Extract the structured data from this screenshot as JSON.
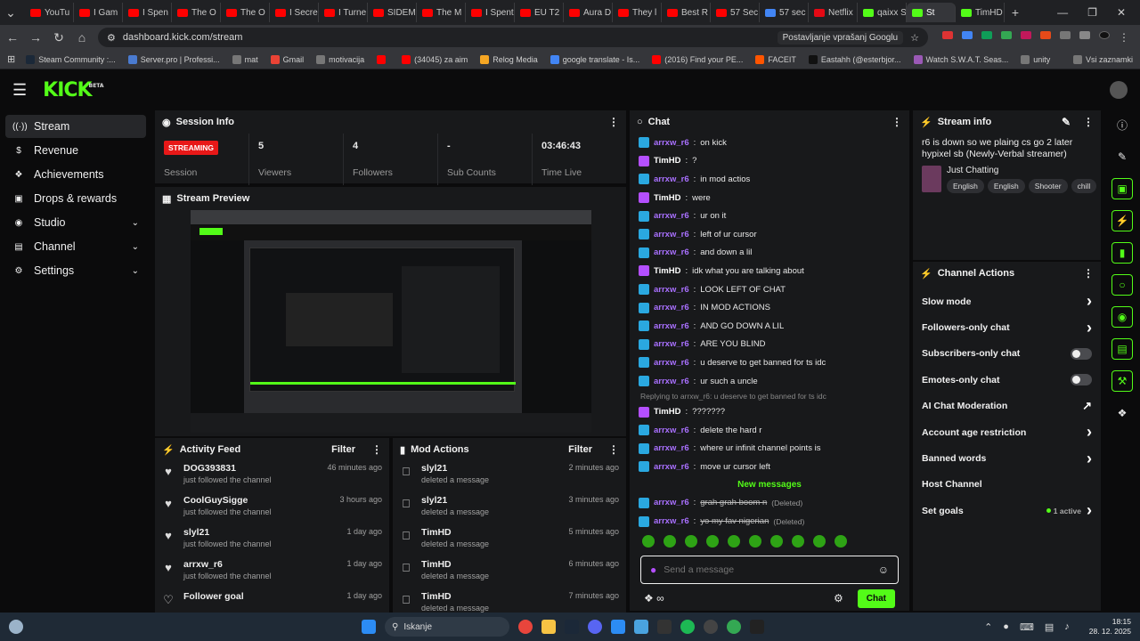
{
  "browser": {
    "tabs": [
      {
        "label": "YouTu",
        "color": "#ff0000"
      },
      {
        "label": "I Gam",
        "color": "#ff0000"
      },
      {
        "label": "I Spen",
        "color": "#ff0000"
      },
      {
        "label": "The O",
        "color": "#ff0000"
      },
      {
        "label": "The O",
        "color": "#ff0000"
      },
      {
        "label": "I Secre",
        "color": "#ff0000"
      },
      {
        "label": "I Turne",
        "color": "#ff0000"
      },
      {
        "label": "SIDEM",
        "color": "#ff0000"
      },
      {
        "label": "The M",
        "color": "#ff0000"
      },
      {
        "label": "I Spent",
        "color": "#ff0000"
      },
      {
        "label": "EU T2",
        "color": "#ff0000"
      },
      {
        "label": "Aura D",
        "color": "#ff0000"
      },
      {
        "label": "They l",
        "color": "#ff0000"
      },
      {
        "label": "Best R",
        "color": "#ff0000"
      },
      {
        "label": "57 Sec",
        "color": "#ff0000"
      },
      {
        "label": "57 sec",
        "color": "#4285f4"
      },
      {
        "label": "Netflix",
        "color": "#e50914"
      },
      {
        "label": "qaixx S",
        "color": "#53fc18"
      },
      {
        "label": "St",
        "color": "#53fc18",
        "active": true
      },
      {
        "label": "TimHD",
        "color": "#53fc18"
      }
    ],
    "url": "dashboard.kick.com/stream",
    "translate_label": "Postavljanje vprašanj Googlu",
    "bookmarks": [
      {
        "label": "Steam Community :...",
        "color": "#1b2838"
      },
      {
        "label": "Server.pro | Professi...",
        "color": "#4a7bd0"
      },
      {
        "label": "mat",
        "color": "#777"
      },
      {
        "label": "Gmail",
        "color": "#ea4335"
      },
      {
        "label": "motivacija",
        "color": "#777"
      },
      {
        "label": "",
        "color": "#ff0000"
      },
      {
        "label": "(34045) za aim",
        "color": "#ff0000"
      },
      {
        "label": "Relog Media",
        "color": "#f5a623"
      },
      {
        "label": "google translate - Is...",
        "color": "#4285f4"
      },
      {
        "label": "(2016) Find your PE...",
        "color": "#ff0000"
      },
      {
        "label": "FACEIT",
        "color": "#ff5500"
      },
      {
        "label": "Eastahh (@esterbjor...",
        "color": "#111"
      },
      {
        "label": "Watch S.W.A.T. Seas...",
        "color": "#9b59b6"
      },
      {
        "label": "unity",
        "color": "#777"
      },
      {
        "label": "Prevedi",
        "color": "#4285f4"
      }
    ],
    "all_bookmarks_label": "Vsi zaznamki"
  },
  "header": {
    "logo": "KICK",
    "logo_sup": "BETA"
  },
  "sidebar": {
    "items": [
      {
        "label": "Stream",
        "icon": "broadcast-icon",
        "glyph": "((·))",
        "selected": true,
        "chev": false
      },
      {
        "label": "Revenue",
        "icon": "money-icon",
        "glyph": "$",
        "chev": false
      },
      {
        "label": "Achievements",
        "icon": "trophy-icon",
        "glyph": "❖",
        "chev": false
      },
      {
        "label": "Drops & rewards",
        "icon": "gift-icon",
        "glyph": "▣",
        "chev": false
      },
      {
        "label": "Studio",
        "icon": "studio-icon",
        "glyph": "◉",
        "chev": true
      },
      {
        "label": "Channel",
        "icon": "channel-icon",
        "glyph": "▤",
        "chev": true
      },
      {
        "label": "Settings",
        "icon": "gear-icon",
        "glyph": "⚙",
        "chev": true
      }
    ]
  },
  "session": {
    "title": "Session Info",
    "live_badge": "STREAMING",
    "session_label": "Session",
    "stats": [
      {
        "value": "5",
        "label": "Viewers"
      },
      {
        "value": "4",
        "label": "Followers"
      },
      {
        "value": "-",
        "label": "Sub Counts"
      },
      {
        "value": "03:46:43",
        "label": "Time Live"
      }
    ]
  },
  "preview": {
    "title": "Stream Preview"
  },
  "activity": {
    "title": "Activity Feed",
    "filter": "Filter",
    "rows": [
      {
        "name": "DOG393831",
        "sub": "just followed the channel",
        "time": "46 minutes ago"
      },
      {
        "name": "CoolGuySigge",
        "sub": "just followed the channel",
        "time": "3 hours ago"
      },
      {
        "name": "slyl21",
        "sub": "just followed the channel",
        "time": "1 day ago"
      },
      {
        "name": "arrxw_r6",
        "sub": "just followed the channel",
        "time": "1 day ago"
      },
      {
        "name": "Follower goal",
        "sub": "",
        "time": "1 day ago"
      }
    ]
  },
  "mod_actions": {
    "title": "Mod Actions",
    "filter": "Filter",
    "rows": [
      {
        "name": "slyl21",
        "sub": "deleted a message",
        "time": "2 minutes ago"
      },
      {
        "name": "slyl21",
        "sub": "deleted a message",
        "time": "3 minutes ago"
      },
      {
        "name": "TimHD",
        "sub": "deleted a message",
        "time": "5 minutes ago"
      },
      {
        "name": "TimHD",
        "sub": "deleted a message",
        "time": "6 minutes ago"
      },
      {
        "name": "TimHD",
        "sub": "deleted a message",
        "time": "7 minutes ago"
      }
    ]
  },
  "chat": {
    "title": "Chat",
    "messages": [
      {
        "user": "arrxw_r6",
        "text": "on kick",
        "color": "#a970ff",
        "badge": "#2aa8e0"
      },
      {
        "user": "TimHD",
        "text": "?",
        "color": "#ffffff",
        "badge": "#b44fff"
      },
      {
        "user": "arrxw_r6",
        "text": "in mod actios",
        "color": "#a970ff",
        "badge": "#2aa8e0"
      },
      {
        "user": "TimHD",
        "text": "were",
        "color": "#ffffff",
        "badge": "#b44fff"
      },
      {
        "user": "arrxw_r6",
        "text": "ur on it",
        "color": "#a970ff",
        "badge": "#2aa8e0"
      },
      {
        "user": "arrxw_r6",
        "text": "left of ur cursor",
        "color": "#a970ff",
        "badge": "#2aa8e0"
      },
      {
        "user": "arrxw_r6",
        "text": "and down a lil",
        "color": "#a970ff",
        "badge": "#2aa8e0"
      },
      {
        "user": "TimHD",
        "text": "idk what you are talking about",
        "color": "#ffffff",
        "badge": "#b44fff"
      },
      {
        "user": "arrxw_r6",
        "text": "LOOK LEFT OF CHAT",
        "color": "#a970ff",
        "badge": "#2aa8e0"
      },
      {
        "user": "arrxw_r6",
        "text": "IN MOD ACTIONS",
        "color": "#a970ff",
        "badge": "#2aa8e0"
      },
      {
        "user": "arrxw_r6",
        "text": "AND GO DOWN A LIL",
        "color": "#a970ff",
        "badge": "#2aa8e0"
      },
      {
        "user": "arrxw_r6",
        "text": "ARE YOU BLIND",
        "color": "#a970ff",
        "badge": "#2aa8e0"
      },
      {
        "user": "arrxw_r6",
        "text": "u deserve to get banned for ts idc",
        "color": "#a970ff",
        "badge": "#2aa8e0"
      },
      {
        "user": "arrxw_r6",
        "text": "ur such a uncle",
        "color": "#a970ff",
        "badge": "#2aa8e0"
      }
    ],
    "reply_note": "Replying to arrxw_r6: u deserve to get banned for ts idc",
    "messages2": [
      {
        "user": "TimHD",
        "text": "???????",
        "color": "#ffffff",
        "badge": "#b44fff"
      },
      {
        "user": "arrxw_r6",
        "text": "delete the hard r",
        "color": "#a970ff",
        "badge": "#2aa8e0"
      },
      {
        "user": "arrxw_r6",
        "text": "where ur infinit channel points is",
        "color": "#a970ff",
        "badge": "#2aa8e0"
      },
      {
        "user": "arrxw_r6",
        "text": "move ur cursor left",
        "color": "#a970ff",
        "badge": "#2aa8e0"
      }
    ],
    "new_messages": "New messages",
    "deleted": [
      {
        "user": "arrxw_r6",
        "text": "grah grah boom n",
        "tag": "(Deleted)"
      },
      {
        "user": "arrxw_r6",
        "text": "yo my fav nigerian",
        "tag": "(Deleted)"
      }
    ],
    "input_placeholder": "Send a message",
    "send_label": "Chat"
  },
  "stream_info": {
    "title": "Stream info",
    "stream_title": "r6 is down so we plaing cs go 2 later hypixel sb (Newly-Verbal streamer)",
    "category": "Just Chatting",
    "tags": [
      "English",
      "English",
      "Shooter",
      "chill"
    ]
  },
  "channel_actions": {
    "title": "Channel Actions",
    "rows": [
      {
        "label": "Slow mode",
        "ctrl": "arrow"
      },
      {
        "label": "Followers-only chat",
        "ctrl": "arrow"
      },
      {
        "label": "Subscribers-only chat",
        "ctrl": "toggle"
      },
      {
        "label": "Emotes-only chat",
        "ctrl": "toggle"
      },
      {
        "label": "AI Chat Moderation",
        "ctrl": "external"
      },
      {
        "label": "Account age restriction",
        "ctrl": "arrow"
      },
      {
        "label": "Banned words",
        "ctrl": "arrow"
      },
      {
        "label": "Host Channel",
        "ctrl": "none"
      },
      {
        "label": "Set goals",
        "ctrl": "active",
        "extra": "1 active"
      }
    ]
  },
  "taskbar": {
    "search_label": "Iskanje",
    "time": "18:15",
    "date": "28. 12. 2025"
  }
}
